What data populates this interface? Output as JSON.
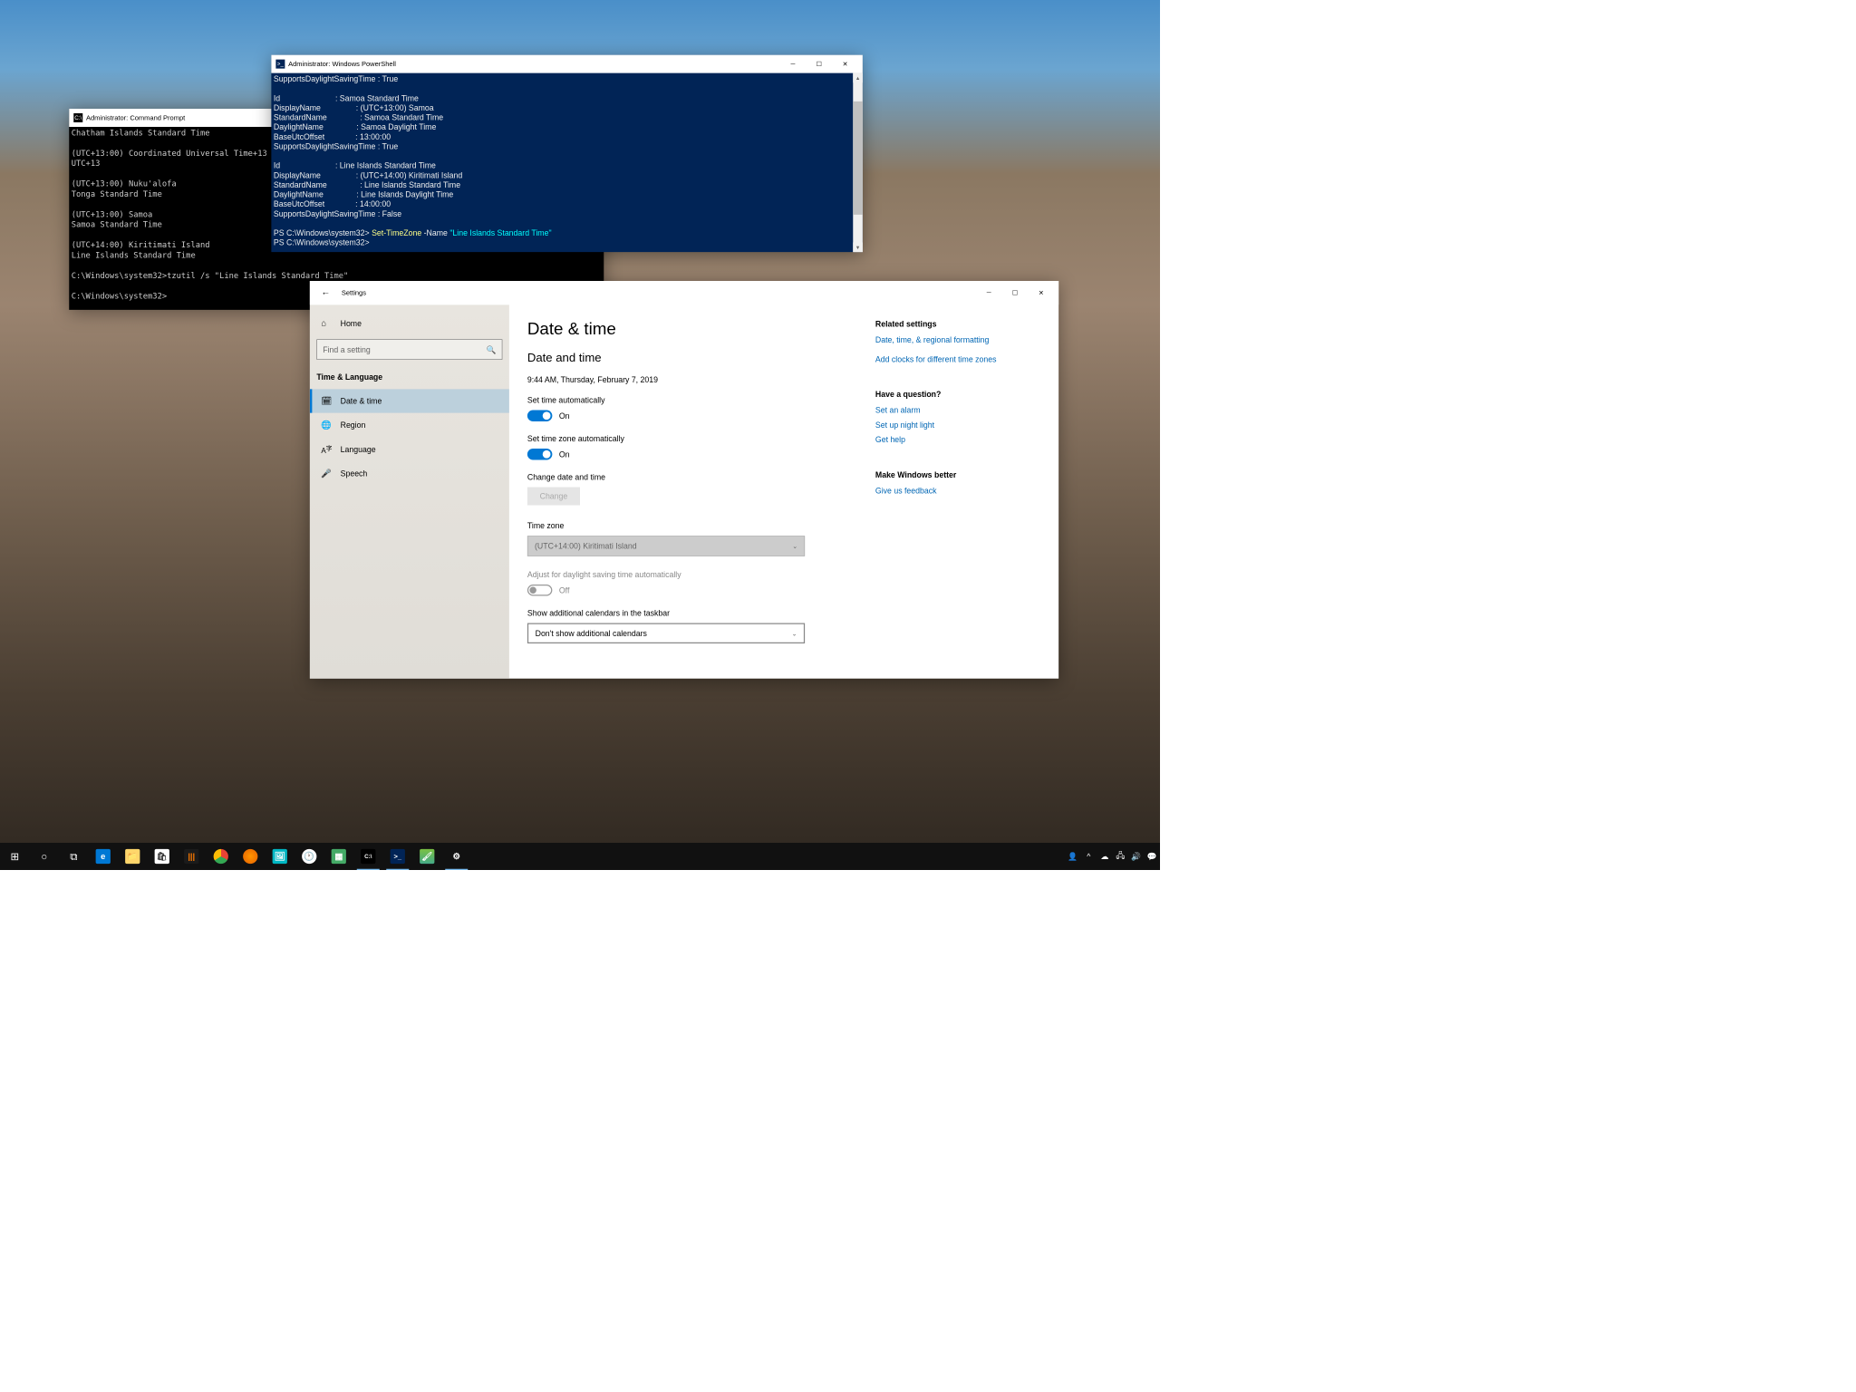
{
  "cmd": {
    "title": "Administrator: Command Prompt",
    "lines": "Chatham Islands Standard Time\n\n(UTC+13:00) Coordinated Universal Time+13\nUTC+13\n\n(UTC+13:00) Nuku'alofa\nTonga Standard Time\n\n(UTC+13:00) Samoa\nSamoa Standard Time\n\n(UTC+14:00) Kiritimati Island\nLine Islands Standard Time\n\nC:\\Windows\\system32>tzutil /s \"Line Islands Standard Time\"\n\nC:\\Windows\\system32>"
  },
  "ps": {
    "title": "Administrator: Windows PowerShell",
    "body1": "SupportsDaylightSavingTime : True\n\nId                         : Samoa Standard Time\nDisplayName                : (UTC+13:00) Samoa\nStandardName               : Samoa Standard Time\nDaylightName               : Samoa Daylight Time\nBaseUtcOffset              : 13:00:00\nSupportsDaylightSavingTime : True\n\nId                         : Line Islands Standard Time\nDisplayName                : (UTC+14:00) Kiritimati Island\nStandardName               : Line Islands Standard Time\nDaylightName               : Line Islands Daylight Time\nBaseUtcOffset              : 14:00:00\nSupportsDaylightSavingTime : False\n\n",
    "prompt1": "PS C:\\Windows\\system32> ",
    "cmd1a": "Set-TimeZone ",
    "cmd1b": "-Name ",
    "cmd1c": "\"Line Islands Standard Time\"",
    "prompt2": "PS C:\\Windows\\system32> "
  },
  "settings": {
    "title": "Settings",
    "home": "Home",
    "searchPlaceholder": "Find a setting",
    "section": "Time & Language",
    "nav": {
      "dateTime": "Date & time",
      "region": "Region",
      "language": "Language",
      "speech": "Speech"
    },
    "h1": "Date & time",
    "h2": "Date and time",
    "now": "9:44 AM, Thursday, February 7, 2019",
    "autoTimeLabel": "Set time automatically",
    "autoTimeState": "On",
    "autoTzLabel": "Set time zone automatically",
    "autoTzState": "On",
    "changeLabel": "Change date and time",
    "changeBtn": "Change",
    "tzHeading": "Time zone",
    "tzValue": "(UTC+14:00) Kiritimati Island",
    "dstLabel": "Adjust for daylight saving time automatically",
    "dstState": "Off",
    "calLabel": "Show additional calendars in the taskbar",
    "calValue": "Don't show additional calendars",
    "related": {
      "title": "Related settings",
      "link1": "Date, time, & regional formatting",
      "link2": "Add clocks for different time zones"
    },
    "question": {
      "title": "Have a question?",
      "link1": "Set an alarm",
      "link2": "Set up night light",
      "link3": "Get help"
    },
    "better": {
      "title": "Make Windows better",
      "link1": "Give us feedback"
    }
  },
  "tray": {
    "chevron": "^"
  }
}
